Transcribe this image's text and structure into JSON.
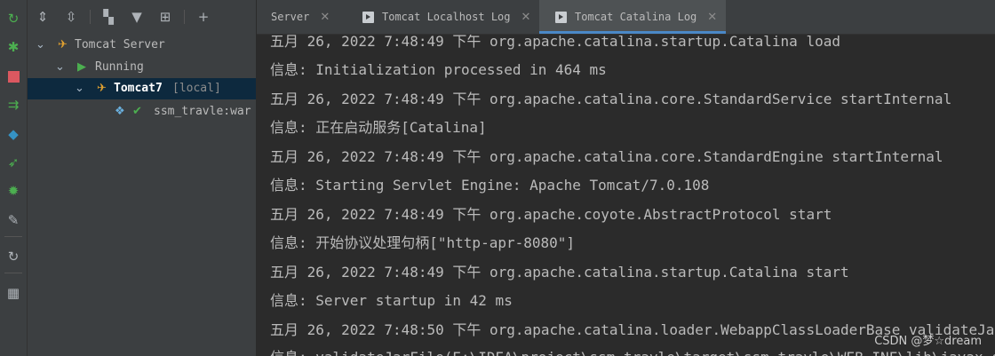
{
  "left_toolbar": {
    "icons": [
      "rerun-icon",
      "debug-icon",
      "stop-icon",
      "deploy-icon",
      "artifacts-icon",
      "run-icon",
      "debug-run-icon",
      "settings-icon",
      "refresh-icon",
      "layout-icon"
    ],
    "colors": {
      "green": "#4caf50",
      "red": "#db5860",
      "blue": "#3592c4",
      "gray": "#aeb3b8"
    }
  },
  "tree_toolbar": {
    "icons": [
      "expand-all-icon",
      "collapse-all-icon",
      "group-icon",
      "filter-icon",
      "open-browser-icon",
      "add-icon"
    ]
  },
  "tree": {
    "server": "Tomcat Server",
    "running": "Running",
    "instance": "Tomcat7",
    "instance_tag": "[local]",
    "artifact": "ssm_travle:war"
  },
  "tabs": [
    {
      "label": "Server",
      "close": "✕"
    },
    {
      "label": "Tomcat Localhost Log",
      "close": "✕"
    },
    {
      "label": "Tomcat Catalina Log",
      "close": "✕"
    }
  ],
  "log_lines": [
    "五月 26, 2022 7:48:49 下午 org.apache.catalina.startup.Catalina load",
    "信息: Initialization processed in 464 ms",
    "五月 26, 2022 7:48:49 下午 org.apache.catalina.core.StandardService startInternal",
    "信息: 正在启动服务[Catalina]",
    "五月 26, 2022 7:48:49 下午 org.apache.catalina.core.StandardEngine startInternal",
    "信息: Starting Servlet Engine: Apache Tomcat/7.0.108",
    "五月 26, 2022 7:48:49 下午 org.apache.coyote.AbstractProtocol start",
    "信息: 开始协议处理句柄[\"http-apr-8080\"]",
    "五月 26, 2022 7:48:49 下午 org.apache.catalina.startup.Catalina start",
    "信息: Server startup in 42 ms",
    "五月 26, 2022 7:48:50 下午 org.apache.catalina.loader.WebappClassLoaderBase validateJarFile",
    "信息: validateJarFile(E:\\IDEA\\project\\ssm_travle\\target\\ssm_travle\\WEB-INF\\lib\\javax.servlet-api"
  ],
  "watermark": "CSDN @梦☆dream"
}
